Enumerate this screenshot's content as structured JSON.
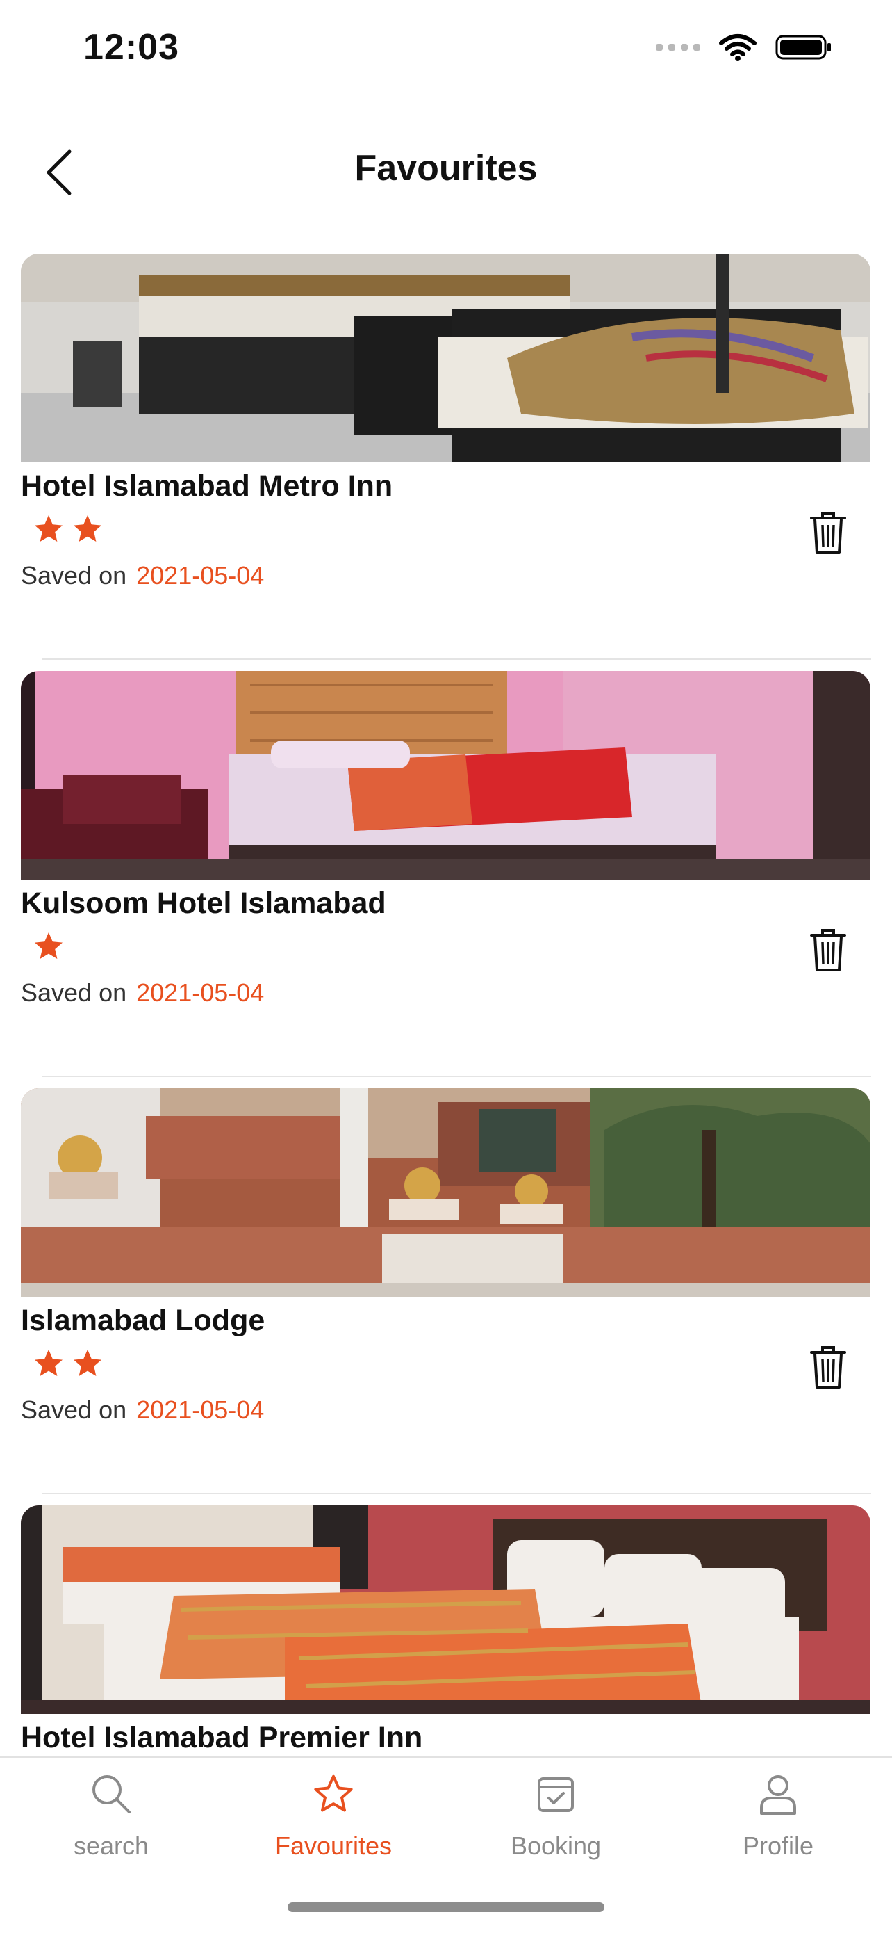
{
  "status_bar": {
    "time": "12:03"
  },
  "header": {
    "title": "Favourites"
  },
  "colors": {
    "accent": "#e8501f",
    "text": "#111111",
    "muted": "#8a8a8a",
    "divider": "#e4e4e4"
  },
  "favourites": [
    {
      "name": "Hotel Islamabad Metro Inn",
      "stars": 2,
      "saved_label": "Saved on",
      "saved_date": "2021-05-04"
    },
    {
      "name": "Kulsoom Hotel Islamabad",
      "stars": 1,
      "saved_label": "Saved on",
      "saved_date": "2021-05-04"
    },
    {
      "name": "Islamabad Lodge",
      "stars": 2,
      "saved_label": "Saved on",
      "saved_date": "2021-05-04"
    },
    {
      "name": "Hotel Islamabad Premier Inn",
      "stars": 0,
      "saved_label": "",
      "saved_date": ""
    }
  ],
  "tabs": [
    {
      "label": "search",
      "icon": "search-icon",
      "active": false
    },
    {
      "label": "Favourites",
      "icon": "star-icon",
      "active": true
    },
    {
      "label": "Booking",
      "icon": "calendar-check-icon",
      "active": false
    },
    {
      "label": "Profile",
      "icon": "person-icon",
      "active": false
    }
  ]
}
